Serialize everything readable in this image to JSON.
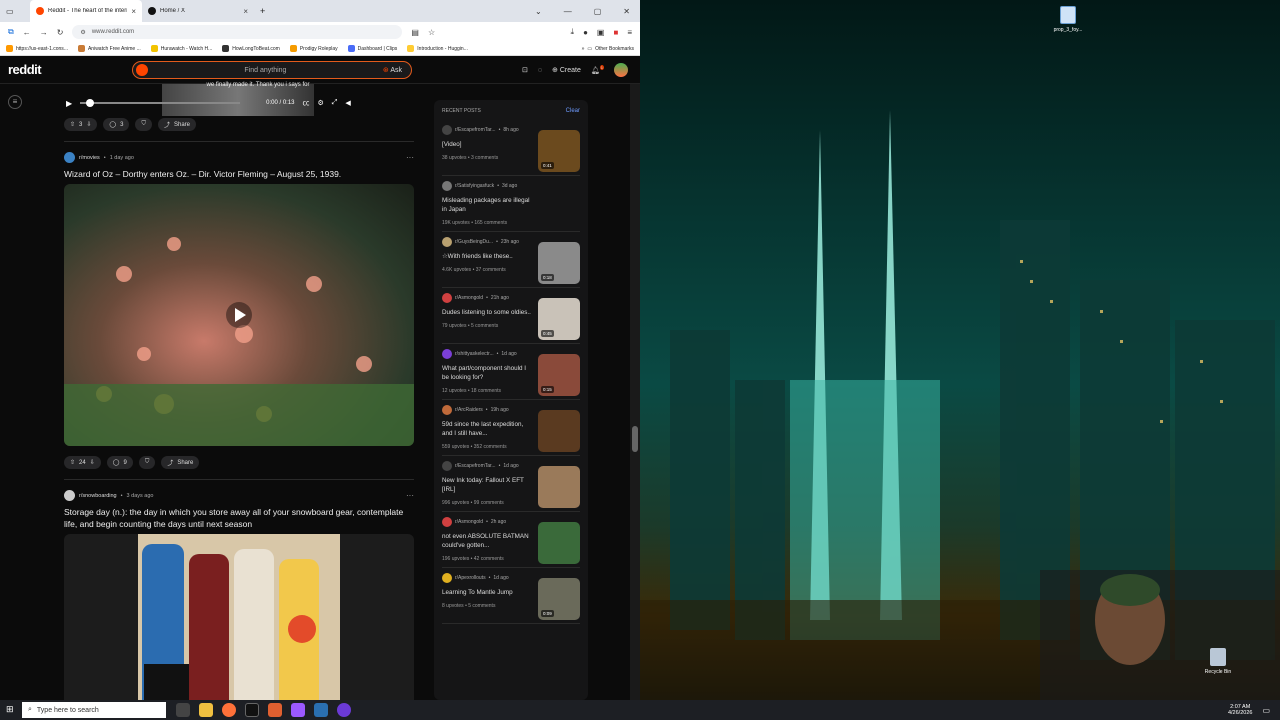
{
  "browser": {
    "tabs": [
      {
        "label": "Reddit - The heart of the intern",
        "color": "#ff4500",
        "active": true
      },
      {
        "label": "Home / X",
        "color": "#111111",
        "active": false
      }
    ],
    "new_tab": "+",
    "url": "www.reddit.com",
    "bookmarks": [
      {
        "label": "https://us-east-1.cons...",
        "color": "#ff9900"
      },
      {
        "label": "Aniwatch Free Anime ...",
        "color": "#c97b36"
      },
      {
        "label": "Hurawatch - Watch H...",
        "color": "#f2c300"
      },
      {
        "label": "HowLongToBeat.com",
        "color": "#333333"
      },
      {
        "label": "Prodigy Roleplay",
        "color": "#f59b00"
      },
      {
        "label": "Dashboard | Clips",
        "color": "#4a6cf7"
      },
      {
        "label": "Introduction - Huggin...",
        "color": "#ffcc33"
      }
    ],
    "other_bookmarks": "Other Bookmarks"
  },
  "reddit": {
    "logo": "reddit",
    "search_placeholder": "Find anything",
    "ask": "Ask",
    "create": "Create",
    "notif_count": "1"
  },
  "video_post": {
    "caption": "we finally made it. Thank you i says for",
    "time": "0:00 / 0:13",
    "votes": "3",
    "comments": "3",
    "share": "Share"
  },
  "posts": [
    {
      "subreddit": "r/movies",
      "age": "1 day ago",
      "title": "Wizard of Oz – Dorthy enters Oz. – Dir. Victor Fleming – August 25, 1939.",
      "votes": "24",
      "comments": "9",
      "share": "Share",
      "icon_color": "#3b82c4"
    },
    {
      "subreddit": "r/snowboarding",
      "age": "3 days ago",
      "title": "Storage day (n.): the day in which you store away all of your snowboard gear, contemplate life, and begin counting the days until next season",
      "icon_color": "#cccccc"
    }
  ],
  "recent": {
    "heading": "RECENT POSTS",
    "clear": "Clear",
    "items": [
      {
        "sub": "r/EscapefromTar...",
        "age": "8h ago",
        "title": "[Video]",
        "upvotes": "38 upvotes",
        "comments": "3 comments",
        "duration": "0:41",
        "icon": "#444444",
        "thumb": "#6b4a1e"
      },
      {
        "sub": "r/Satisfyingasfuck",
        "age": "3d ago",
        "title": "Misleading packages are illegal in Japan",
        "upvotes": "19K upvotes",
        "comments": "165 comments",
        "duration": "",
        "icon": "#777777",
        "thumb": ""
      },
      {
        "sub": "r/GuysBeingDu...",
        "age": "23h ago",
        "title": "☆With friends like these..",
        "upvotes": "4.6K upvotes",
        "comments": "37 comments",
        "duration": "0:18",
        "icon": "#b8a070",
        "thumb": "#8a8a8a"
      },
      {
        "sub": "r/Asmongold",
        "age": "21h ago",
        "title": "Dudes listening to some oldies..",
        "upvotes": "79 upvotes",
        "comments": "5 comments",
        "duration": "0:45",
        "icon": "#d04040",
        "thumb": "#c9c2b8"
      },
      {
        "sub": "r/shittyaskelectr...",
        "age": "1d ago",
        "title": "What part/component should I be looking for?",
        "upvotes": "12 upvotes",
        "comments": "18 comments",
        "duration": "0:15",
        "icon": "#7b3fd6",
        "thumb": "#8a4a3a"
      },
      {
        "sub": "r/ArcRaiders",
        "age": "19h ago",
        "title": "59d since the last expedition, and I still have...",
        "upvotes": "559 upvotes",
        "comments": "352 comments",
        "duration": "",
        "icon": "#c06a3a",
        "thumb": "#5a3a20"
      },
      {
        "sub": "r/EscapefromTar...",
        "age": "1d ago",
        "title": "New Ink today: Fallout X EFT [IRL]",
        "upvotes": "996 upvotes",
        "comments": "99 comments",
        "duration": "",
        "icon": "#444444",
        "thumb": "#9a7a5a"
      },
      {
        "sub": "r/Asmongold",
        "age": "2h ago",
        "title": "not even ABSOLUTE BATMAN could've gotten...",
        "upvotes": "196 upvotes",
        "comments": "42 comments",
        "duration": "",
        "icon": "#d04040",
        "thumb": "#3a6a3a"
      },
      {
        "sub": "r/Apexrollouts",
        "age": "1d ago",
        "title": "Learning To Mantle Jump",
        "upvotes": "8 upvotes",
        "comments": "5 comments",
        "duration": "0:09",
        "icon": "#e0b020",
        "thumb": "#6a6a5a"
      }
    ]
  },
  "desktop": {
    "file_icon": "prop_3_foy...",
    "recycle_bin": "Recycle Bin"
  },
  "taskbar": {
    "search_placeholder": "Type here to search",
    "time": "2:07 AM",
    "date": "4/26/2026"
  }
}
